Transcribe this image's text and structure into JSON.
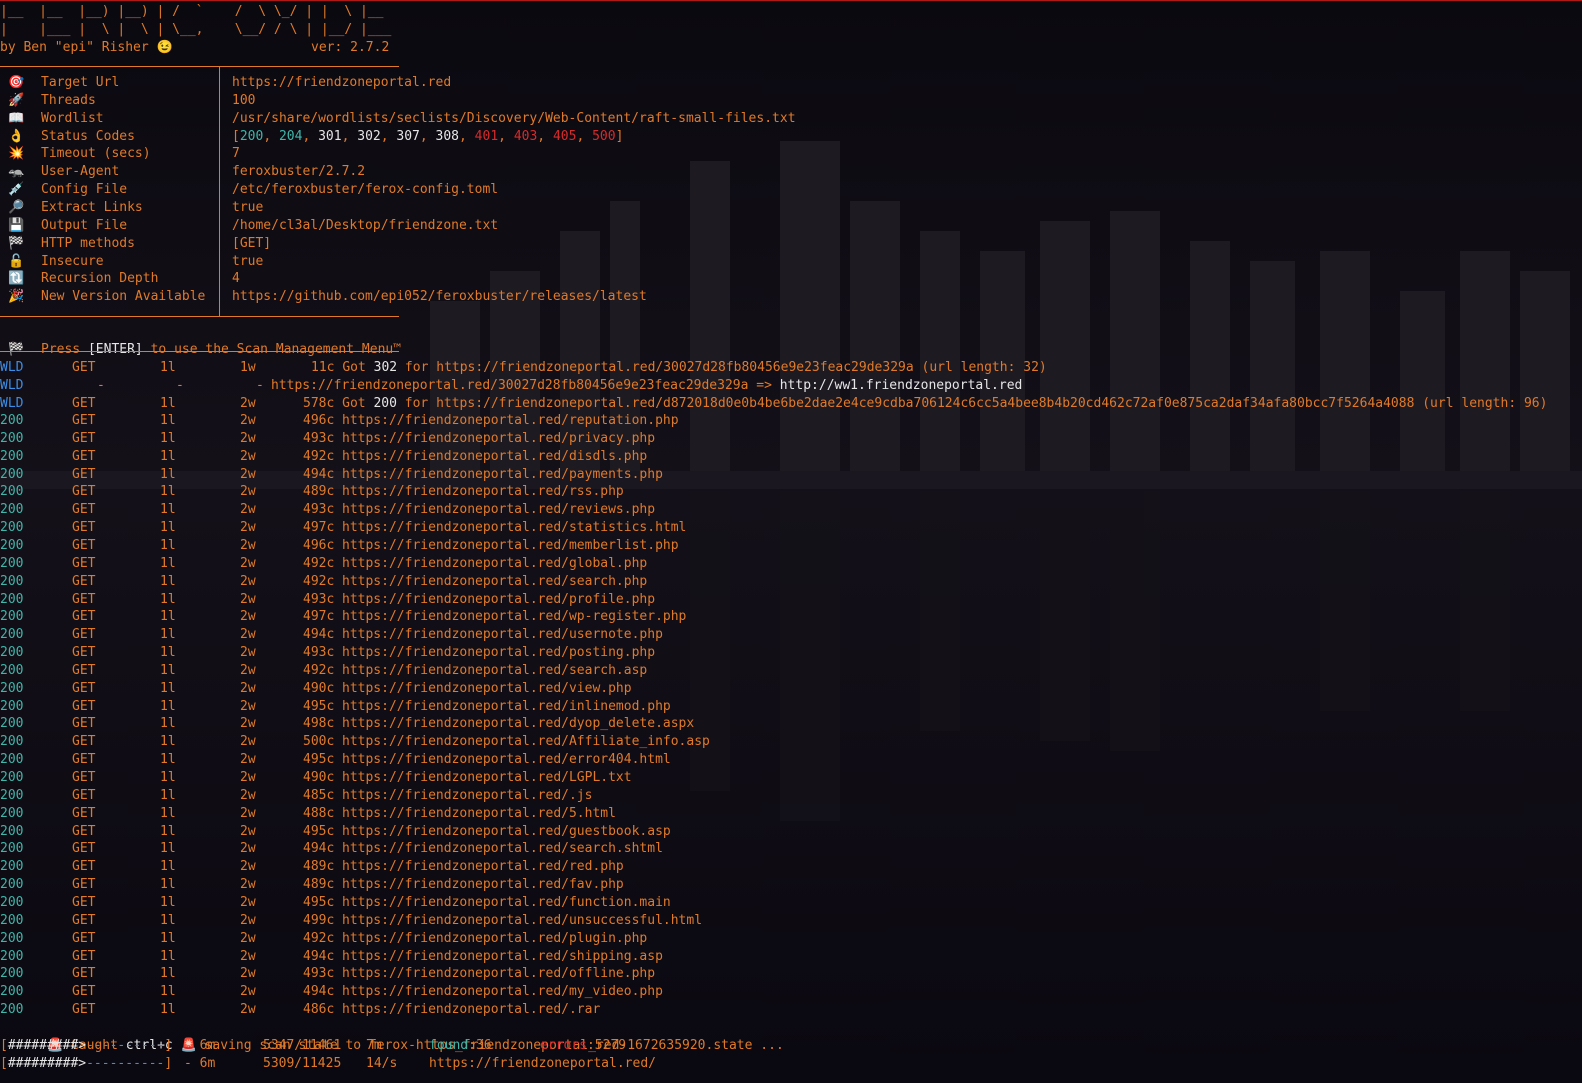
{
  "banner": {
    "art_line1": "|__  |__  |__) |__) | /  `    /  \\ \\_/ | |  \\ |__",
    "art_line2": "|    |___ |  \\ |  \\ | \\__,    \\__/ / \\ | |__/ |___",
    "author": "by Ben \"epi\" Risher 😉",
    "version": "ver: 2.7.2"
  },
  "config": [
    {
      "icon": "🎯",
      "key": "Target Url",
      "value": "https://friendzoneportal.red"
    },
    {
      "icon": "🚀",
      "key": "Threads",
      "value": "100"
    },
    {
      "icon": "📖",
      "key": "Wordlist",
      "value": "/usr/share/wordlists/seclists/Discovery/Web-Content/raft-small-files.txt"
    },
    {
      "icon": "👌",
      "key": "Status Codes",
      "value": ""
    },
    {
      "icon": "💥",
      "key": "Timeout (secs)",
      "value": "7"
    },
    {
      "icon": "🦡",
      "key": "User-Agent",
      "value": "feroxbuster/2.7.2"
    },
    {
      "icon": "💉",
      "key": "Config File",
      "value": "/etc/feroxbuster/ferox-config.toml"
    },
    {
      "icon": "🔎",
      "key": "Extract Links",
      "value": "true"
    },
    {
      "icon": "💾",
      "key": "Output File",
      "value": "/home/cl3al/Desktop/friendzone.txt"
    },
    {
      "icon": "🏁",
      "key": "HTTP methods",
      "value": "[GET]"
    },
    {
      "icon": "🔓",
      "key": "Insecure",
      "value": "true"
    },
    {
      "icon": "🔃",
      "key": "Recursion Depth",
      "value": "4"
    },
    {
      "icon": "🎉",
      "key": "New Version Available",
      "value": "https://github.com/epi052/feroxbuster/releases/latest"
    }
  ],
  "status_codes": [
    {
      "code": "200",
      "color": "#3fb6a8"
    },
    {
      "code": "204",
      "color": "#3fb6a8"
    },
    {
      "code": "301",
      "color": "#e6e6e6"
    },
    {
      "code": "302",
      "color": "#e6e6e6"
    },
    {
      "code": "307",
      "color": "#e6e6e6"
    },
    {
      "code": "308",
      "color": "#e6e6e6"
    },
    {
      "code": "401",
      "color": "#d62b2b"
    },
    {
      "code": "403",
      "color": "#d62b2b"
    },
    {
      "code": "405",
      "color": "#d62b2b"
    },
    {
      "code": "500",
      "color": "#d62b2b"
    }
  ],
  "menu_prompt": {
    "icon": "🏁",
    "prefix": "Press ",
    "key": "[ENTER]",
    "suffix": " to use the Scan Management Menu™"
  },
  "wildcards": [
    {
      "status": "WLD",
      "method": "GET",
      "lines": "1l",
      "words": "1w",
      "chars": "11c",
      "pre": "Got ",
      "code": "302",
      "text": " for https://friendzoneportal.red/30027d28fb80456e9e23feac29de329a (url length: 32)"
    },
    {
      "status": "WLD",
      "method": "-",
      "lines": "-",
      "words": "-",
      "chars": "",
      "pre": "",
      "code": "",
      "text": "https://friendzoneportal.red/30027d28fb80456e9e23feac29de329a => ",
      "redirect": "http://ww1.friendzoneportal.red"
    },
    {
      "status": "WLD",
      "method": "GET",
      "lines": "1l",
      "words": "2w",
      "chars": "578c",
      "pre": "Got ",
      "code": "200",
      "text": " for https://friendzoneportal.red/d872018d0e0b4be6be2dae2e4ce9cdba706124c6cc5a4bee8b4b20cd462c72af0e875ca2daf34afa80bcc7f5264a4088 (url length: 96)"
    }
  ],
  "results": [
    {
      "status": "200",
      "method": "GET",
      "lines": "1l",
      "words": "2w",
      "chars": "496c",
      "url": "https://friendzoneportal.red/reputation.php"
    },
    {
      "status": "200",
      "method": "GET",
      "lines": "1l",
      "words": "2w",
      "chars": "493c",
      "url": "https://friendzoneportal.red/privacy.php"
    },
    {
      "status": "200",
      "method": "GET",
      "lines": "1l",
      "words": "2w",
      "chars": "492c",
      "url": "https://friendzoneportal.red/disdls.php"
    },
    {
      "status": "200",
      "method": "GET",
      "lines": "1l",
      "words": "2w",
      "chars": "494c",
      "url": "https://friendzoneportal.red/payments.php"
    },
    {
      "status": "200",
      "method": "GET",
      "lines": "1l",
      "words": "2w",
      "chars": "489c",
      "url": "https://friendzoneportal.red/rss.php"
    },
    {
      "status": "200",
      "method": "GET",
      "lines": "1l",
      "words": "2w",
      "chars": "493c",
      "url": "https://friendzoneportal.red/reviews.php"
    },
    {
      "status": "200",
      "method": "GET",
      "lines": "1l",
      "words": "2w",
      "chars": "497c",
      "url": "https://friendzoneportal.red/statistics.html"
    },
    {
      "status": "200",
      "method": "GET",
      "lines": "1l",
      "words": "2w",
      "chars": "496c",
      "url": "https://friendzoneportal.red/memberlist.php"
    },
    {
      "status": "200",
      "method": "GET",
      "lines": "1l",
      "words": "2w",
      "chars": "492c",
      "url": "https://friendzoneportal.red/global.php"
    },
    {
      "status": "200",
      "method": "GET",
      "lines": "1l",
      "words": "2w",
      "chars": "492c",
      "url": "https://friendzoneportal.red/search.php"
    },
    {
      "status": "200",
      "method": "GET",
      "lines": "1l",
      "words": "2w",
      "chars": "493c",
      "url": "https://friendzoneportal.red/profile.php"
    },
    {
      "status": "200",
      "method": "GET",
      "lines": "1l",
      "words": "2w",
      "chars": "497c",
      "url": "https://friendzoneportal.red/wp-register.php"
    },
    {
      "status": "200",
      "method": "GET",
      "lines": "1l",
      "words": "2w",
      "chars": "494c",
      "url": "https://friendzoneportal.red/usernote.php"
    },
    {
      "status": "200",
      "method": "GET",
      "lines": "1l",
      "words": "2w",
      "chars": "493c",
      "url": "https://friendzoneportal.red/posting.php"
    },
    {
      "status": "200",
      "method": "GET",
      "lines": "1l",
      "words": "2w",
      "chars": "492c",
      "url": "https://friendzoneportal.red/search.asp"
    },
    {
      "status": "200",
      "method": "GET",
      "lines": "1l",
      "words": "2w",
      "chars": "490c",
      "url": "https://friendzoneportal.red/view.php"
    },
    {
      "status": "200",
      "method": "GET",
      "lines": "1l",
      "words": "2w",
      "chars": "495c",
      "url": "https://friendzoneportal.red/inlinemod.php"
    },
    {
      "status": "200",
      "method": "GET",
      "lines": "1l",
      "words": "2w",
      "chars": "498c",
      "url": "https://friendzoneportal.red/dyop_delete.aspx"
    },
    {
      "status": "200",
      "method": "GET",
      "lines": "1l",
      "words": "2w",
      "chars": "500c",
      "url": "https://friendzoneportal.red/Affiliate_info.asp"
    },
    {
      "status": "200",
      "method": "GET",
      "lines": "1l",
      "words": "2w",
      "chars": "495c",
      "url": "https://friendzoneportal.red/error404.html"
    },
    {
      "status": "200",
      "method": "GET",
      "lines": "1l",
      "words": "2w",
      "chars": "490c",
      "url": "https://friendzoneportal.red/LGPL.txt"
    },
    {
      "status": "200",
      "method": "GET",
      "lines": "1l",
      "words": "2w",
      "chars": "485c",
      "url": "https://friendzoneportal.red/.js"
    },
    {
      "status": "200",
      "method": "GET",
      "lines": "1l",
      "words": "2w",
      "chars": "488c",
      "url": "https://friendzoneportal.red/5.html"
    },
    {
      "status": "200",
      "method": "GET",
      "lines": "1l",
      "words": "2w",
      "chars": "495c",
      "url": "https://friendzoneportal.red/guestbook.asp"
    },
    {
      "status": "200",
      "method": "GET",
      "lines": "1l",
      "words": "2w",
      "chars": "494c",
      "url": "https://friendzoneportal.red/search.shtml"
    },
    {
      "status": "200",
      "method": "GET",
      "lines": "1l",
      "words": "2w",
      "chars": "489c",
      "url": "https://friendzoneportal.red/red.php"
    },
    {
      "status": "200",
      "method": "GET",
      "lines": "1l",
      "words": "2w",
      "chars": "489c",
      "url": "https://friendzoneportal.red/fav.php"
    },
    {
      "status": "200",
      "method": "GET",
      "lines": "1l",
      "words": "2w",
      "chars": "495c",
      "url": "https://friendzoneportal.red/function.main"
    },
    {
      "status": "200",
      "method": "GET",
      "lines": "1l",
      "words": "2w",
      "chars": "499c",
      "url": "https://friendzoneportal.red/unsuccessful.html"
    },
    {
      "status": "200",
      "method": "GET",
      "lines": "1l",
      "words": "2w",
      "chars": "492c",
      "url": "https://friendzoneportal.red/plugin.php"
    },
    {
      "status": "200",
      "method": "GET",
      "lines": "1l",
      "words": "2w",
      "chars": "494c",
      "url": "https://friendzoneportal.red/shipping.asp"
    },
    {
      "status": "200",
      "method": "GET",
      "lines": "1l",
      "words": "2w",
      "chars": "493c",
      "url": "https://friendzoneportal.red/offline.php"
    },
    {
      "status": "200",
      "method": "GET",
      "lines": "1l",
      "words": "2w",
      "chars": "494c",
      "url": "https://friendzoneportal.red/my_video.php"
    },
    {
      "status": "200",
      "method": "GET",
      "lines": "1l",
      "words": "2w",
      "chars": "486c",
      "url": "https://friendzoneportal.red/.rar"
    }
  ],
  "interrupt": {
    "icon": "🚨",
    "text1": " Caught ",
    "key": "ctrl+c",
    "text2": " saving scan state to ferox-https_friendzoneportal_red-1672635920.state ..."
  },
  "progress": [
    {
      "done": "#########>",
      "todo": "----------",
      "elapsed": "- 6m",
      "count": "5347/11461",
      "eta": "7m",
      "found_label": "found",
      "found_value": ":36",
      "errors_label": "errors",
      "errors_value": ":5279",
      "url": ""
    },
    {
      "done": "#########>",
      "todo": "----------",
      "elapsed": "- 6m",
      "count": "5309/11425",
      "eta": "14/s",
      "found_label": "",
      "found_value": "",
      "errors_label": "",
      "errors_value": "",
      "url": "https://friendzoneportal.red/"
    }
  ],
  "colors": {
    "accent": "#e07a2a",
    "teal": "#3fb6a8",
    "wld": "#3a8ee6",
    "error": "#d62b2b",
    "background": "#0a0810"
  }
}
